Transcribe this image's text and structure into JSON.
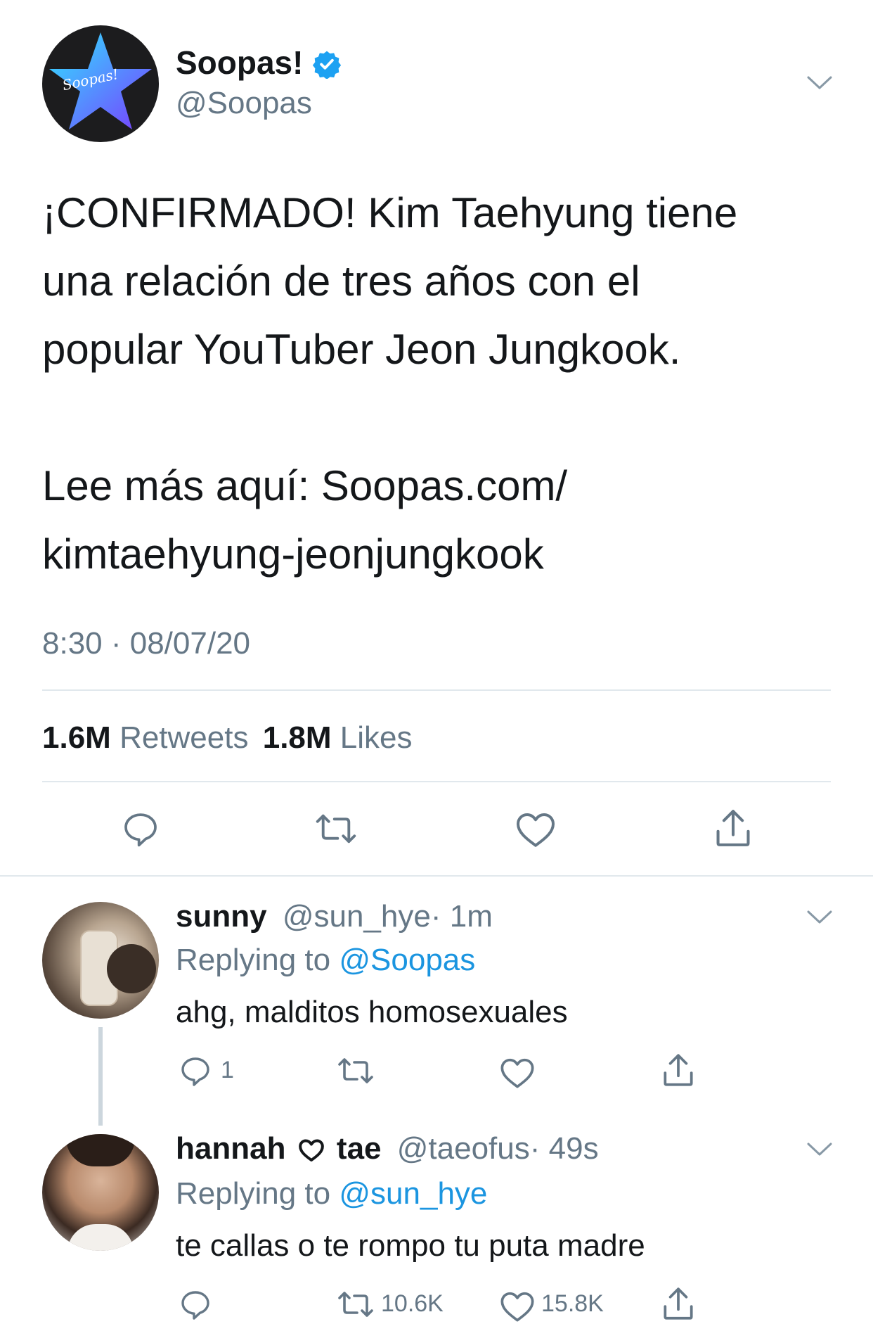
{
  "tweet": {
    "display_name": "Soopas!",
    "handle": "@Soopas",
    "avatar_text": "Soopas!",
    "body_lines": [
      "¡CONFIRMADO! Kim Taehyung tiene",
      "una relación de tres años con el",
      "popular YouTuber Jeon Jungkook.",
      "Lee más aquí: Soopas.com/",
      "kimtaehyung-jeonjungkook"
    ],
    "timestamp": "8:30 · 08/07/20",
    "stats": {
      "retweets_count": "1.6M",
      "retweets_label": "Retweets",
      "likes_count": "1.8M",
      "likes_label": "Likes"
    }
  },
  "replies": [
    {
      "display_name": "sunny",
      "handle": "@sun_hye",
      "time": "· 1m",
      "replying_label": "Replying to",
      "replying_to": "@Soopas",
      "text": "ahg, malditos homosexuales",
      "reply_count": "1",
      "retweet_count": "",
      "like_count": ""
    },
    {
      "display_name_a": "hannah",
      "display_name_b": "tae",
      "handle": "@taeofus",
      "time": "· 49s",
      "replying_label": "Replying to",
      "replying_to": "@sun_hye",
      "text": "te callas o te rompo tu puta madre",
      "reply_count": "",
      "retweet_count": "10.6K",
      "like_count": "15.8K"
    }
  ],
  "colors": {
    "text": "#14171a",
    "muted": "#657786",
    "link": "#1b95e0",
    "verified": "#1da1f2",
    "divider": "#e1e8ed"
  },
  "icons": [
    "verified-badge-icon",
    "chevron-down-icon",
    "reply-icon",
    "retweet-icon",
    "like-icon",
    "share-icon"
  ]
}
